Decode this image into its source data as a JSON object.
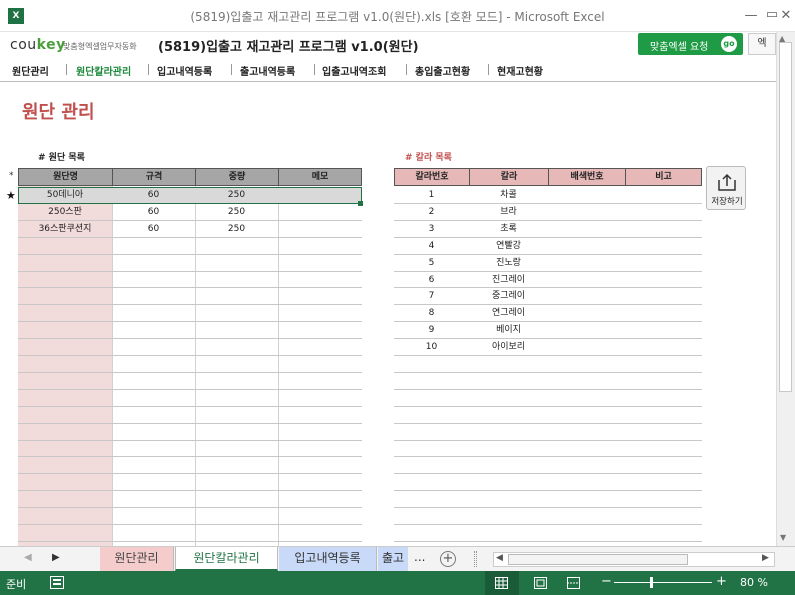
{
  "window": {
    "title": "(5819)입출고 재고관리 프로그램 v1.0(원단).xls  [호환 모드] - Microsoft Excel",
    "app_icon": "X",
    "min": "—",
    "restore": "▭",
    "close": "✕"
  },
  "header": {
    "logo_co": "cou",
    "logo_key": "key",
    "logo_sub": "맞춤형엑셀업무자동화",
    "program_title": "(5819)입출고 재고관리 프로그램 v1.0(원단)",
    "custom_button": "맞춤엑셀 요청",
    "custom_go": "go",
    "extra_button": "엑"
  },
  "nav": [
    {
      "label": "원단관리"
    },
    {
      "label": "원단칼라관리"
    },
    {
      "label": "입고내역등록"
    },
    {
      "label": "출고내역등록"
    },
    {
      "label": "입출고내역조회"
    },
    {
      "label": "총입출고현황"
    },
    {
      "label": "현재고현황"
    }
  ],
  "page_title": "원단 관리",
  "fabric_section": {
    "label": "# 원단 목록",
    "headers": [
      "원단명",
      "규격",
      "중량",
      "메모"
    ],
    "marker_header": "*",
    "marker_current": "★",
    "rows": [
      {
        "name": "50데니아",
        "spec": "60",
        "weight": "250",
        "memo": ""
      },
      {
        "name": "250스판",
        "spec": "60",
        "weight": "250",
        "memo": ""
      },
      {
        "name": "36스판쿠션지",
        "spec": "60",
        "weight": "250",
        "memo": ""
      }
    ]
  },
  "color_section": {
    "label": "# 칼라 목록",
    "headers": [
      "칼라번호",
      "칼라",
      "배색번호",
      "비고"
    ],
    "rows": [
      {
        "no": "1",
        "color": "차콜"
      },
      {
        "no": "2",
        "color": "브라"
      },
      {
        "no": "3",
        "color": "초록"
      },
      {
        "no": "4",
        "color": "연빨강"
      },
      {
        "no": "5",
        "color": "진노랑"
      },
      {
        "no": "6",
        "color": "진그레이"
      },
      {
        "no": "7",
        "color": "중그레이"
      },
      {
        "no": "8",
        "color": "연그레이"
      },
      {
        "no": "9",
        "color": "베이지"
      },
      {
        "no": "10",
        "color": "아이보리"
      }
    ]
  },
  "save_button": {
    "label": "저장하기",
    "icon": "upload-icon"
  },
  "sheet_tabs": [
    {
      "label": "원단관리",
      "color": "#f4cccc"
    },
    {
      "label": "원단칼라관리",
      "color": "#ffffff"
    },
    {
      "label": "입고내역등록",
      "color": "#c9daf8"
    },
    {
      "label": "출고",
      "color": "#c9daf8"
    }
  ],
  "tab_more": "...",
  "tab_add": "+",
  "status": {
    "ready": "준비",
    "zoom": "80 %",
    "zoom_minus": "−",
    "zoom_plus": "+"
  },
  "colors": {
    "accent_green": "#217346",
    "title_red": "#c0504d",
    "fabric_header": "#a6a6a6",
    "color_header": "#e6b8b7",
    "name_col": "#f2dcdb"
  }
}
